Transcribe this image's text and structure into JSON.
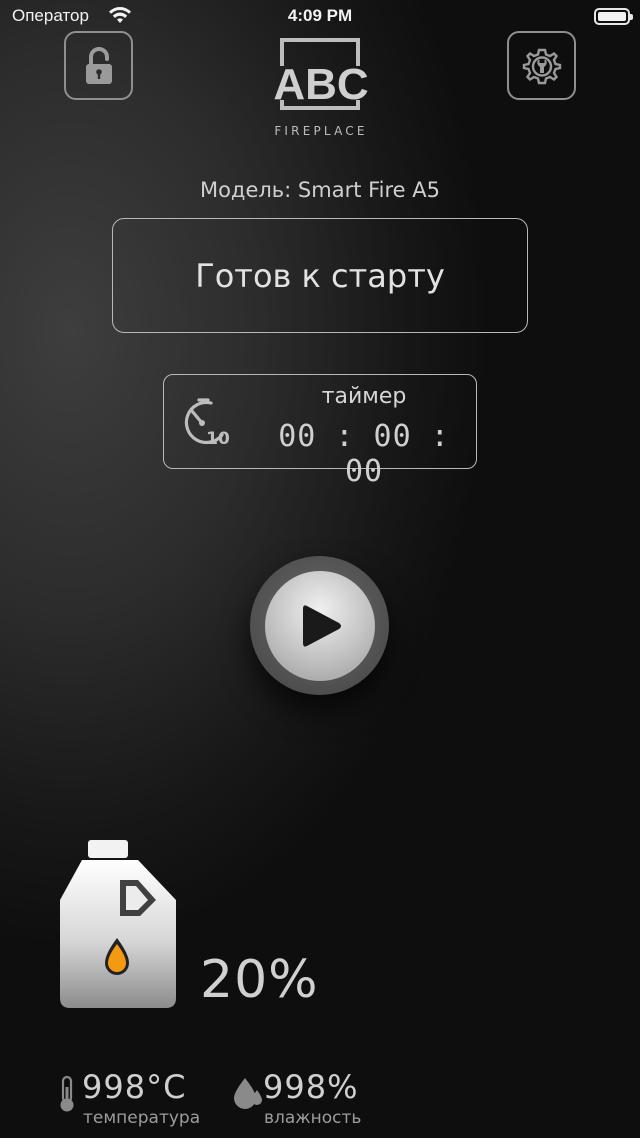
{
  "status_bar": {
    "carrier": "Оператор",
    "time": "4:09 PM"
  },
  "header": {
    "lock_icon": "unlocked-padlock-icon",
    "settings_icon": "gear-wrench-icon",
    "logo_text": "ABC",
    "logo_subtext": "FIREPLACE"
  },
  "model": {
    "label": "Модель: Smart Fire A5"
  },
  "status": {
    "text": "Готов к старту"
  },
  "timer": {
    "label": "таймер",
    "value": "00 : 00 : 00",
    "icon_badge": "10"
  },
  "play": {
    "icon": "play-icon"
  },
  "fuel": {
    "percent_text": "20%",
    "level": 0.2,
    "drop_color": "#f39a12"
  },
  "temperature": {
    "value": "998°C",
    "label": "температура"
  },
  "humidity": {
    "value": "998%",
    "label": "влажность"
  }
}
